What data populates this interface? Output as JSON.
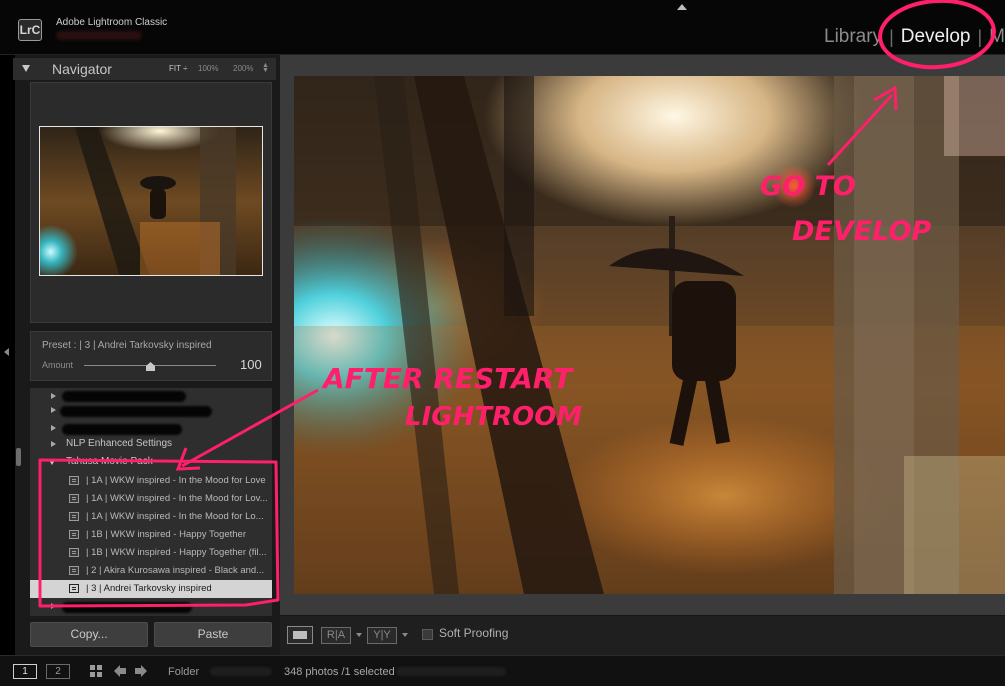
{
  "app": {
    "logo": "LrC",
    "name": "Adobe Lightroom Classic"
  },
  "modules": {
    "library": "Library",
    "develop": "Develop",
    "next": "M",
    "separator": "|"
  },
  "navigator": {
    "title": "Navigator",
    "zoom_fit": "FIT ÷",
    "zoom_100": "100%",
    "zoom_200": "200%"
  },
  "preset_amount": {
    "preset_label": "Preset : | 3 | Andrei Tarkovsky inspired",
    "amount_label": "Amount",
    "amount_value": "100",
    "amount_level_fraction": 0.5
  },
  "preset_folders": {
    "nlp": "NLP Enhanced Settings",
    "tahusa": "Tahusa Movie Pack"
  },
  "presets": [
    "| 1A | WKW inspired - In the Mood for Love",
    "| 1A | WKW inspired - In the Mood for Lov...",
    "| 1A | WKW inspired - In the Mood for Lo...",
    "| 1B | WKW inspired - Happy Together",
    "| 1B | WKW inspired - Happy Together (fil...",
    "| 2 | Akira Kurosawa inspired - Black and...",
    "| 3 | Andrei Tarkovsky inspired"
  ],
  "buttons": {
    "copy": "Copy...",
    "paste": "Paste"
  },
  "toolbar": {
    "before_after_1": "R|A",
    "before_after_2": "Y|Y",
    "soft_proofing": "Soft Proofing"
  },
  "filmstrip": {
    "screen_1": "1",
    "screen_2": "2",
    "folder_label": "Folder",
    "status": "348 photos /1 selected"
  },
  "annotations": {
    "go_to_line1": "GO TO",
    "go_to_line2": "DEVELOP",
    "after_line1": "AFTER RESTART",
    "after_line2": "LIGHTROOM"
  },
  "colors": {
    "annotation": "#ff1f6a",
    "panel_bg": "#2e2e2e",
    "selected_row": "#d4d4d4",
    "active_module": "#f0f0f0"
  },
  "icons": {
    "grid": "grid-icon",
    "back": "back-arrow-icon",
    "forward": "forward-arrow-icon",
    "preset": "preset-icon"
  }
}
